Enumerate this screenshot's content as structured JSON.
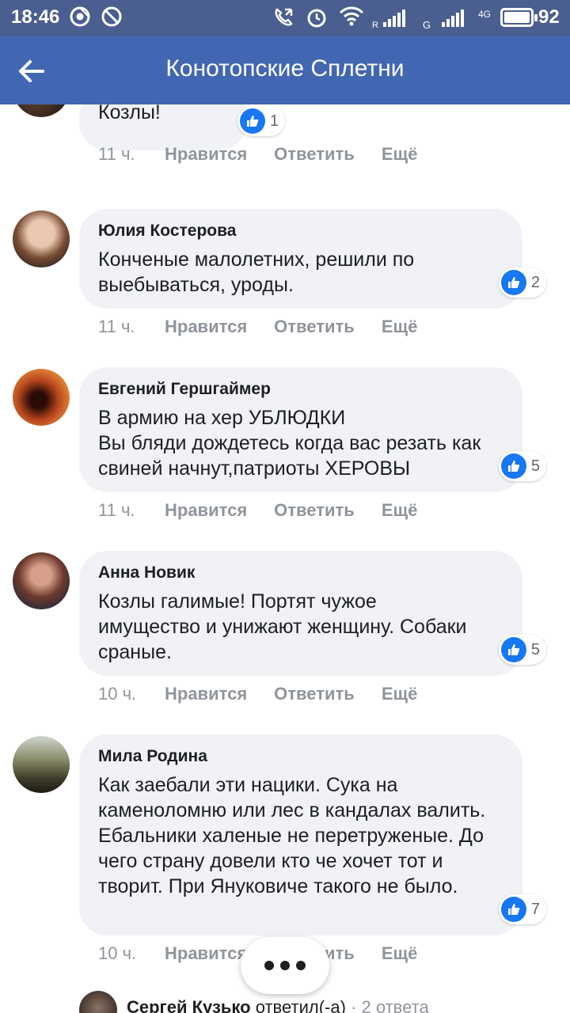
{
  "status_bar": {
    "time": "18:46",
    "battery_pct": "92",
    "network_labels": [
      "R",
      "G",
      "4G"
    ],
    "icons": [
      "chrome-icon",
      "do-not-disturb-icon",
      "call-forward-icon",
      "alarm-icon",
      "wifi-icon",
      "signal-icon",
      "signal-icon",
      "lte-icon",
      "battery-icon"
    ]
  },
  "header": {
    "title": "Конотопские Сплетни",
    "back_icon": "back-arrow-icon"
  },
  "colors": {
    "status_bar": "#4a5f8f",
    "header": "#4267b2",
    "bubble": "#f0f2f5",
    "like": "#1877f2",
    "muted": "#90949c"
  },
  "comments": [
    {
      "name": "",
      "text": "Козлы!",
      "likes": "1",
      "time": "11 ч.",
      "like_label": "Нравится",
      "reply_label": "Ответить",
      "more_label": "Ещё"
    },
    {
      "name": "Юлия Костерова",
      "text": "Конченые малолетних, решили по выебываться, уроды.",
      "likes": "2",
      "time": "11 ч.",
      "like_label": "Нравится",
      "reply_label": "Ответить",
      "more_label": "Ещё"
    },
    {
      "name": "Евгений Гершгаймер",
      "text": "В армию на хер УБЛЮДКИ\nВы бляди дождетесь когда вас резать как свиней начнут,патриоты ХЕРОВЫ",
      "likes": "5",
      "time": "11 ч.",
      "like_label": "Нравится",
      "reply_label": "Ответить",
      "more_label": "Ещё"
    },
    {
      "name": "Анна Новик",
      "text": "Козлы галимые! Портят чужое имущество и унижают женщину. Собаки сраные.",
      "likes": "5",
      "time": "10 ч.",
      "like_label": "Нравится",
      "reply_label": "Ответить",
      "more_label": "Ещё"
    },
    {
      "name": "Мила Родина",
      "text": "Как заебали эти нацики. Сука на каменоломню или лес в кандалах валить. Ебальники халеные не перетруженые. До чего страну довели кто че хочет тот и творит. При Януковиче такого не было.",
      "likes": "7",
      "time": "10 ч.",
      "like_label": "Нравится",
      "reply_label": "Ответить",
      "more_label": "Ещё"
    }
  ],
  "reply_preview": {
    "name": "Сергей Кузько",
    "action": "ответил(-а)",
    "separator": "·",
    "count": "2 ответа"
  }
}
